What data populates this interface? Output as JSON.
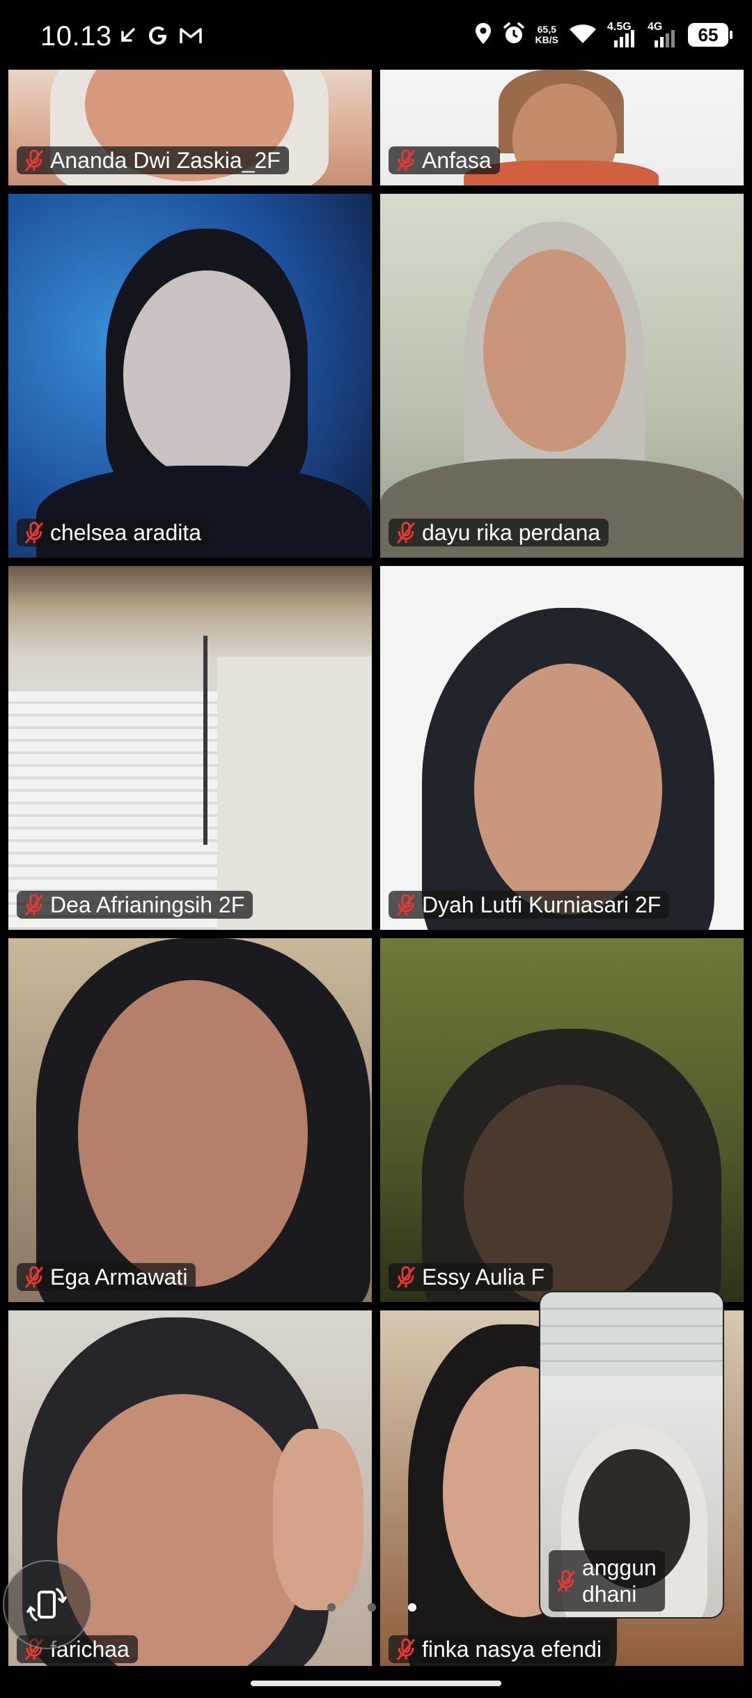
{
  "status_bar": {
    "time": "10.13",
    "net_speed_value": "65,5",
    "net_speed_unit": "KB/S",
    "network_1": "4.5G",
    "network_2": "4G",
    "battery": "65",
    "icons": [
      "missed-call-icon",
      "google-icon",
      "gmail-icon",
      "location-icon",
      "alarm-icon",
      "wifi-icon",
      "signal-icon",
      "signal-icon",
      "battery-icon"
    ]
  },
  "participants": [
    {
      "name": "Ananda Dwi Zaskia_2F",
      "muted": true
    },
    {
      "name": "Anfasa",
      "muted": true
    },
    {
      "name": "chelsea aradita",
      "muted": true
    },
    {
      "name": "dayu rika perdana",
      "muted": true
    },
    {
      "name": "Dea Afrianingsih 2F",
      "muted": true
    },
    {
      "name": "Dyah Lutfi Kurniasari 2F",
      "muted": true
    },
    {
      "name": "Ega Armawati",
      "muted": true
    },
    {
      "name": "Essy Aulia F",
      "muted": true
    },
    {
      "name": "farichaa",
      "muted": true
    },
    {
      "name": "finka nasya efendi",
      "muted": true
    }
  ],
  "self_view": {
    "name_line1": "anggun",
    "name_line2": "dhani",
    "muted": true
  },
  "pager": {
    "pages": 3,
    "active_index": 2
  },
  "colors": {
    "mute_red": "#e53935",
    "label_bg": "#141414",
    "background": "#000000"
  }
}
